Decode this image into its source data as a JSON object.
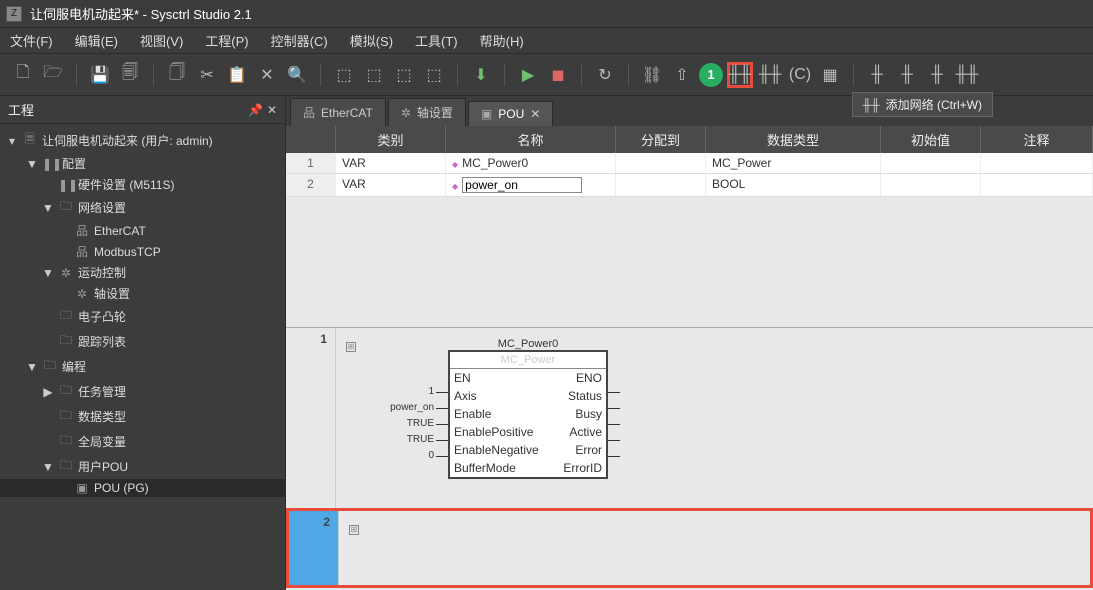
{
  "window": {
    "title": "让伺服电机动起来* - Sysctrl Studio 2.1"
  },
  "menu": {
    "file": "文件(F)",
    "edit": "编辑(E)",
    "view": "视图(V)",
    "project": "工程(P)",
    "controller": "控制器(C)",
    "simulate": "模拟(S)",
    "tools": "工具(T)",
    "help": "帮助(H)"
  },
  "toolbar_badge1": "1",
  "tooltip": {
    "text": "添加网络 (Ctrl+W)"
  },
  "sidebar": {
    "title": "工程",
    "root": "让伺服电机动起来 (用户: admin)",
    "items": [
      {
        "ind": 1,
        "tw": "▼",
        "ico": "❚❚",
        "label": "配置"
      },
      {
        "ind": 2,
        "tw": "",
        "ico": "❚❚",
        "label": "硬件设置 (M511S)"
      },
      {
        "ind": 2,
        "tw": "▼",
        "ico": "🗀",
        "label": "网络设置"
      },
      {
        "ind": 3,
        "tw": "",
        "ico": "品",
        "label": "EtherCAT"
      },
      {
        "ind": 3,
        "tw": "",
        "ico": "品",
        "label": "ModbusTCP"
      },
      {
        "ind": 2,
        "tw": "▼",
        "ico": "✲",
        "label": "运动控制"
      },
      {
        "ind": 3,
        "tw": "",
        "ico": "✲",
        "label": "轴设置"
      },
      {
        "ind": 2,
        "tw": "",
        "ico": "🗀",
        "label": "电子凸轮"
      },
      {
        "ind": 2,
        "tw": "",
        "ico": "🗀",
        "label": "跟踪列表"
      },
      {
        "ind": 1,
        "tw": "▼",
        "ico": "🗀",
        "label": "编程"
      },
      {
        "ind": 2,
        "tw": "▶",
        "ico": "🗀",
        "label": "任务管理"
      },
      {
        "ind": 2,
        "tw": "",
        "ico": "🗀",
        "label": "数据类型"
      },
      {
        "ind": 2,
        "tw": "",
        "ico": "🗀",
        "label": "全局变量"
      },
      {
        "ind": 2,
        "tw": "▼",
        "ico": "🗀",
        "label": "用户POU"
      },
      {
        "ind": 3,
        "tw": "",
        "ico": "▣",
        "label": "POU (PG)",
        "sel": true
      }
    ]
  },
  "tabs": [
    {
      "icon": "品",
      "label": "EtherCAT"
    },
    {
      "icon": "✲",
      "label": "轴设置"
    },
    {
      "icon": "▣",
      "label": "POU",
      "active": true,
      "closable": true
    }
  ],
  "varTable": {
    "headers": {
      "category": "类别",
      "name": "名称",
      "assign": "分配到",
      "type": "数据类型",
      "init": "初始值",
      "comment": "注释"
    },
    "rows": [
      {
        "num": "1",
        "cat": "VAR",
        "name": "MC_Power0",
        "type": "MC_Power"
      },
      {
        "num": "2",
        "cat": "VAR",
        "name": "power_on",
        "type": "BOOL",
        "editing": true
      }
    ]
  },
  "fbd": {
    "net1": {
      "num": "1",
      "instName": "MC_Power0",
      "blockType": "MC_Power",
      "left": [
        "EN",
        "Axis",
        "Enable",
        "EnablePositive",
        "EnableNegative",
        "BufferMode"
      ],
      "right": [
        "ENO",
        "Status",
        "Busy",
        "Active",
        "Error",
        "ErrorID"
      ],
      "inputs": [
        "",
        "1",
        "power_on",
        "TRUE",
        "TRUE",
        "0"
      ]
    },
    "net2": {
      "num": "2",
      "badge": "2"
    }
  }
}
